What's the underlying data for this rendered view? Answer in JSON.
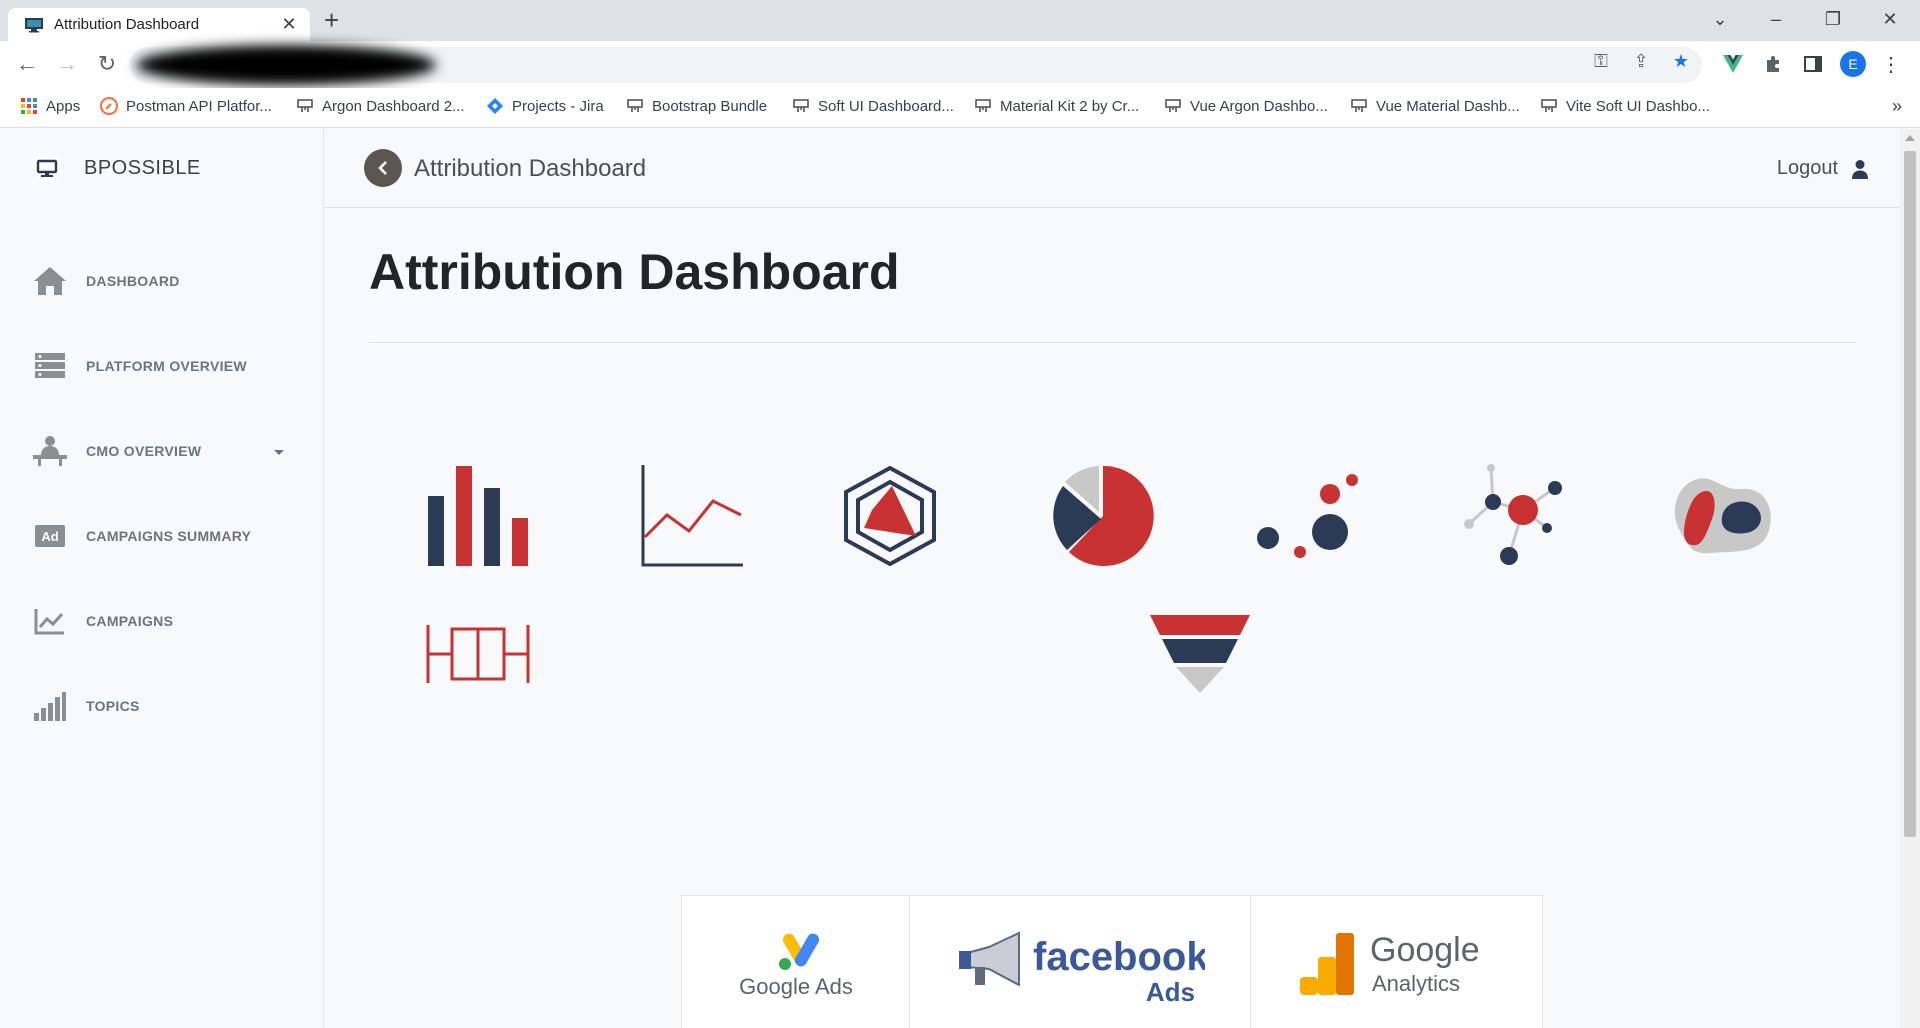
{
  "browser": {
    "tab_title": "Attribution Dashboard",
    "new_tab": "+",
    "close": "✕",
    "avatar_letter": "E",
    "bookmarks": [
      {
        "label": "Apps",
        "icon": "apps-grid-icon"
      },
      {
        "label": "Postman API Platfor...",
        "icon": "postman-icon"
      },
      {
        "label": "Argon Dashboard 2...",
        "icon": "creative-tim-icon"
      },
      {
        "label": "Projects - Jira",
        "icon": "jira-icon"
      },
      {
        "label": "Bootstrap Bundle",
        "icon": "creative-tim-icon"
      },
      {
        "label": "Soft UI Dashboard...",
        "icon": "creative-tim-icon"
      },
      {
        "label": "Material Kit 2 by Cr...",
        "icon": "creative-tim-icon"
      },
      {
        "label": "Vue Argon Dashbo...",
        "icon": "creative-tim-icon"
      },
      {
        "label": "Vue Material Dashb...",
        "icon": "creative-tim-icon"
      },
      {
        "label": "Vite Soft UI Dashbo...",
        "icon": "creative-tim-icon"
      }
    ],
    "more": "»"
  },
  "sidebar": {
    "brand": "BPOSSIBLE",
    "items": [
      {
        "label": "DASHBOARD",
        "icon": "home-icon"
      },
      {
        "label": "PLATFORM OVERVIEW",
        "icon": "server-icon"
      },
      {
        "label": "CMO OVERVIEW",
        "icon": "presenter-icon"
      },
      {
        "label": "CAMPAIGNS SUMMARY",
        "icon": "ad-icon"
      },
      {
        "label": "CAMPAIGNS",
        "icon": "chart-line-icon"
      },
      {
        "label": "TOPICS",
        "icon": "signal-bars-icon"
      }
    ]
  },
  "header": {
    "title": "Attribution Dashboard",
    "logout": "Logout"
  },
  "main": {
    "heading": "Attribution Dashboard",
    "tiles": [
      "bar-chart-icon",
      "line-chart-icon",
      "hexagon-radar-icon",
      "pie-chart-icon",
      "bubble-chart-icon",
      "network-graph-icon",
      "blob-chart-icon",
      "boxplot-icon",
      "funnel-chart-icon"
    ],
    "partners": [
      {
        "name": "Google Ads",
        "icon": "google-ads-logo"
      },
      {
        "name": "facebook",
        "sub": "Ads",
        "icon": "facebook-ads-logo"
      },
      {
        "name": "Google",
        "sub": "Analytics",
        "icon": "google-analytics-logo"
      }
    ]
  },
  "colors": {
    "navy": "#2b3a55",
    "red": "#c83232",
    "grey": "#c8c8c8"
  }
}
